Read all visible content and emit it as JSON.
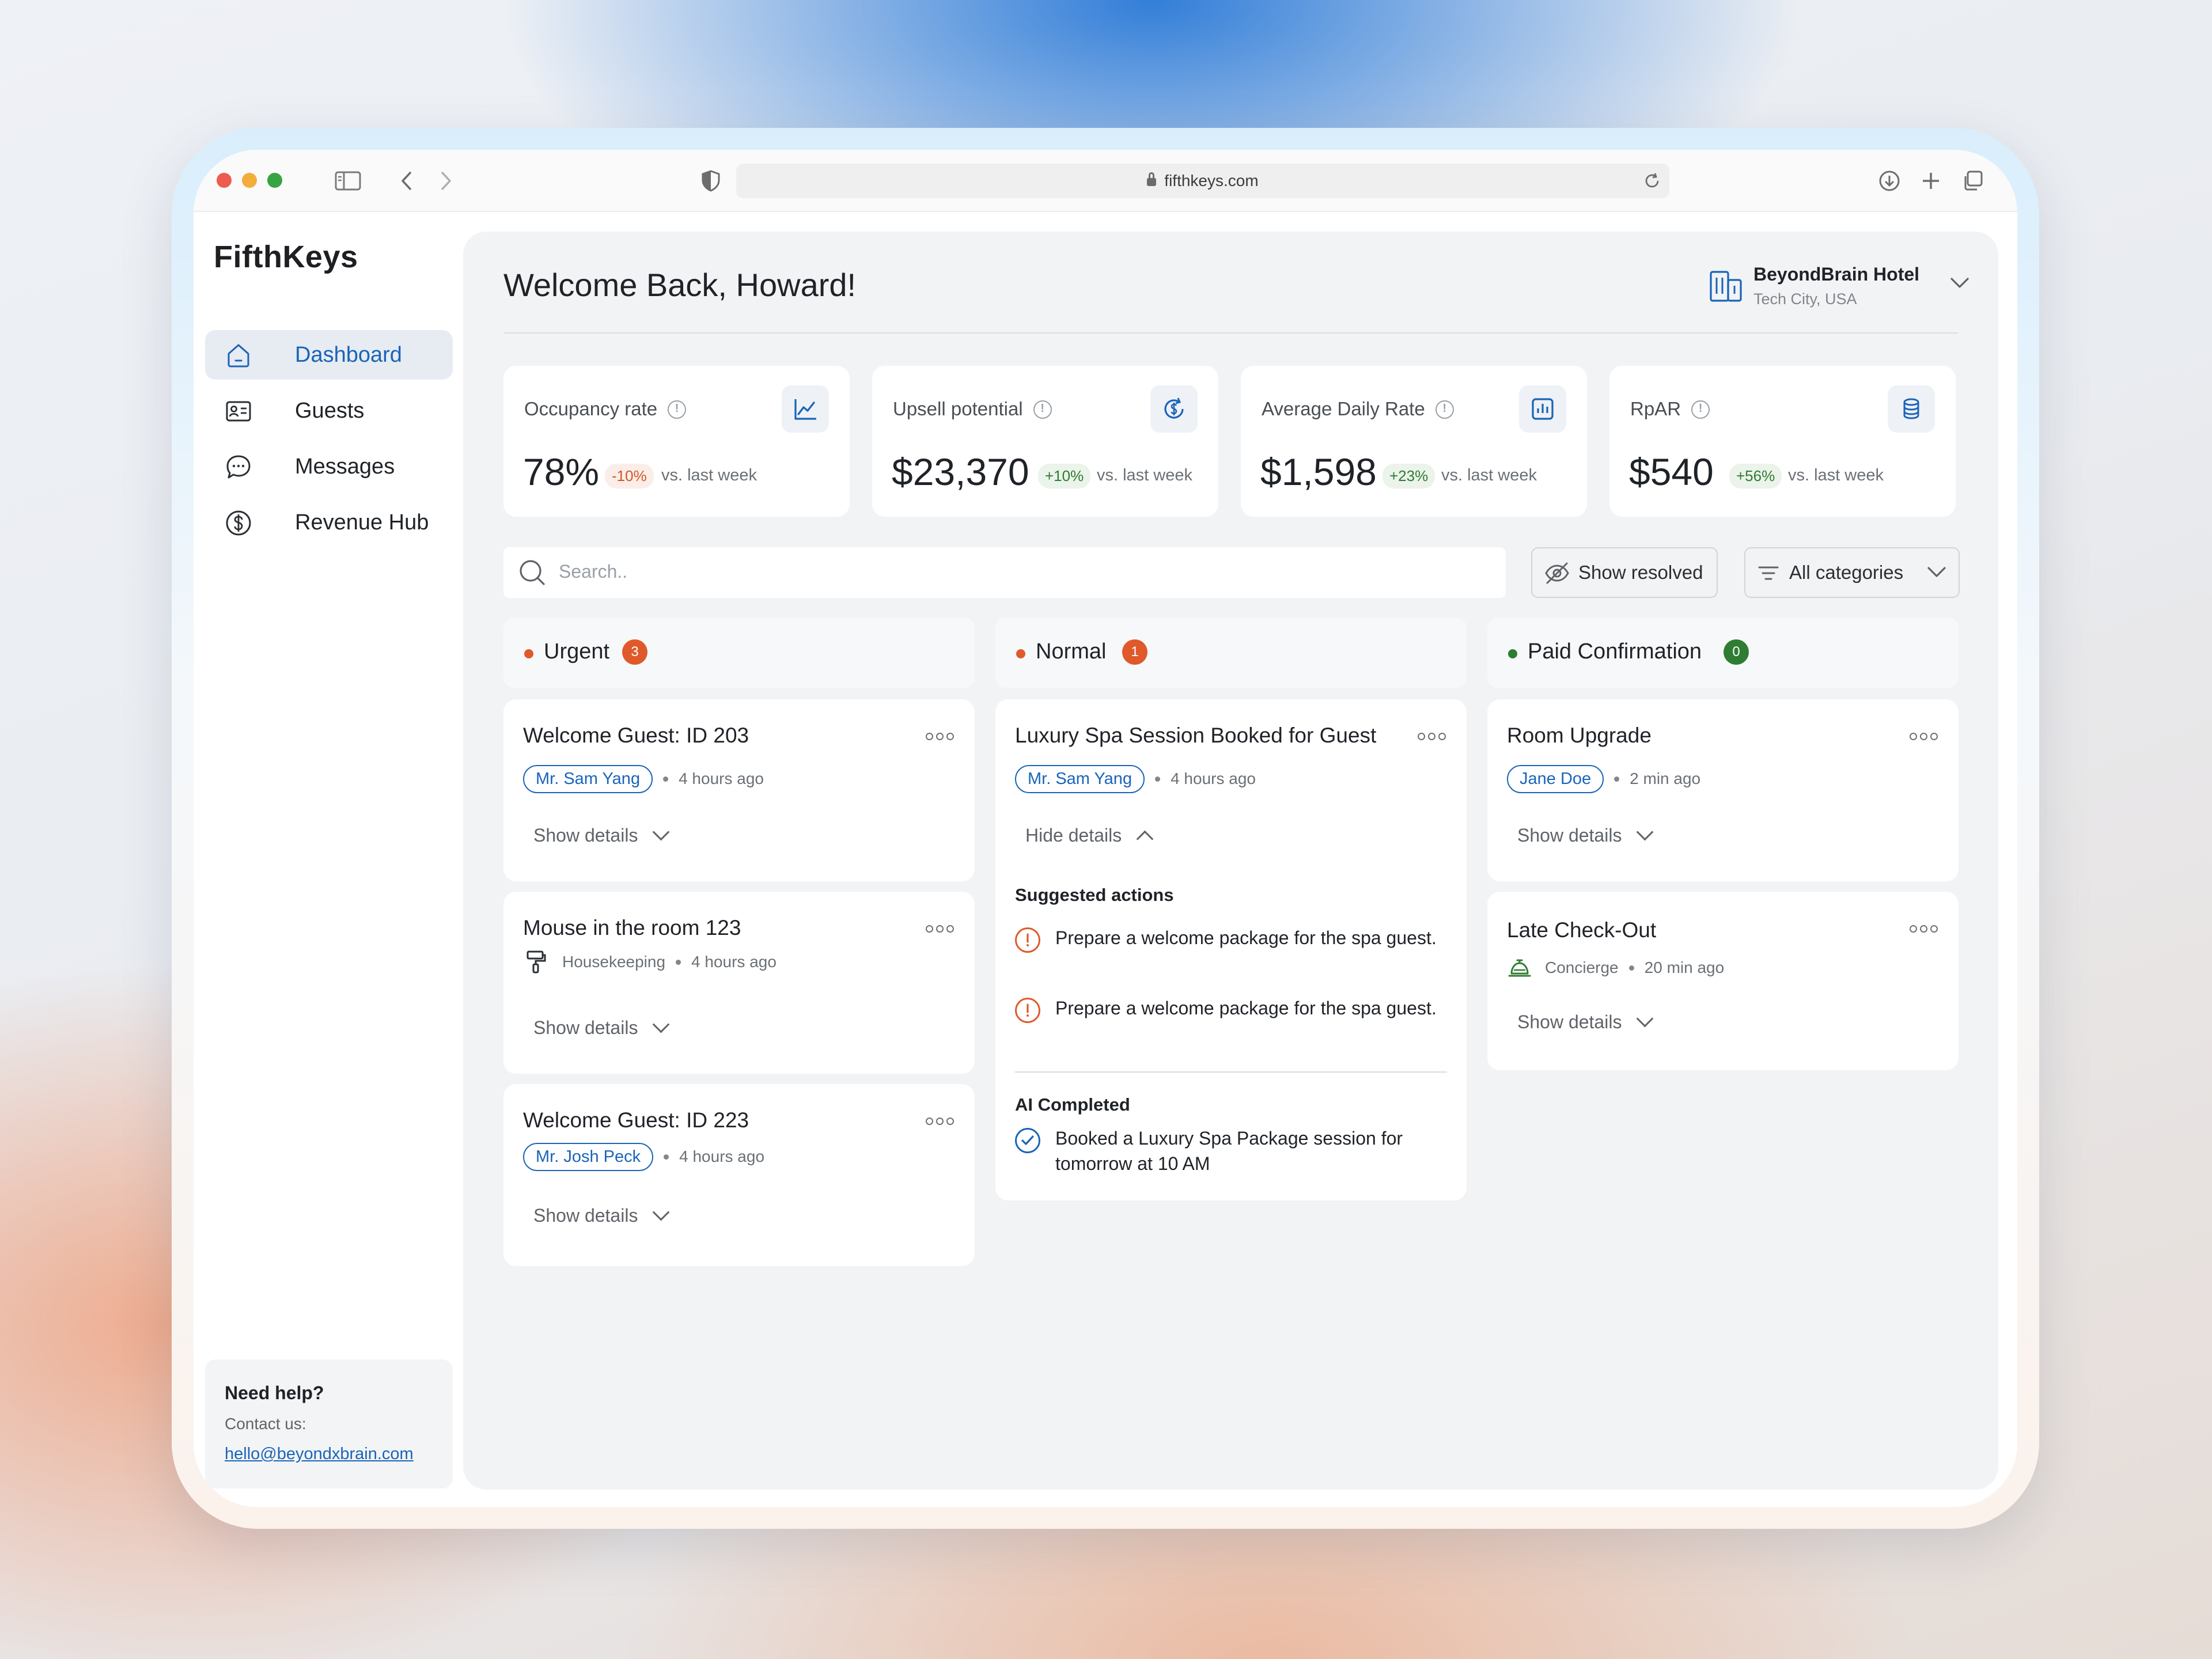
{
  "browser": {
    "url": "fifthkeys.com"
  },
  "sidebar": {
    "brand": "FifthKeys",
    "items": [
      {
        "label": "Dashboard",
        "icon": "home-icon",
        "active": true
      },
      {
        "label": "Guests",
        "icon": "id-card-icon"
      },
      {
        "label": "Messages",
        "icon": "chat-icon"
      },
      {
        "label": "Revenue Hub",
        "icon": "dollar-icon"
      }
    ],
    "help": {
      "title": "Need help?",
      "contact": "Contact us:",
      "email": "hello@beyondxbrain.com"
    }
  },
  "header": {
    "welcome": "Welcome Back, Howard!",
    "hotel": {
      "name": "BeyondBrain Hotel",
      "location": "Tech City, USA"
    }
  },
  "stats": [
    {
      "title": "Occupancy rate",
      "value": "78%",
      "delta": "-10%",
      "trend": "negative",
      "vs": "vs. last week",
      "icon": "line-chart-icon"
    },
    {
      "title": "Upsell potential",
      "value": "$23,370",
      "delta": "+10%",
      "trend": "positive",
      "vs": "vs. last week",
      "icon": "dollar-refresh-icon"
    },
    {
      "title": "Average Daily Rate",
      "value": "$1,598",
      "delta": "+23%",
      "trend": "positive",
      "vs": "vs. last week",
      "icon": "bar-chart-icon"
    },
    {
      "title": "RpAR",
      "value": "$540",
      "delta": "+56%",
      "trend": "positive",
      "vs": "vs. last week",
      "icon": "coins-icon"
    }
  ],
  "toolbar": {
    "search_placeholder": "Search..",
    "show_resolved": "Show resolved",
    "categories": "All categories"
  },
  "columns": [
    {
      "name": "Urgent",
      "count": "3",
      "color": "#e0592a"
    },
    {
      "name": "Normal",
      "count": "1",
      "color": "#e0592a"
    },
    {
      "name": "Paid Confirmation",
      "count": "0",
      "color": "#2e7d32"
    }
  ],
  "cards": {
    "urgent": [
      {
        "title": "Welcome Guest: ID 203",
        "tag": "Mr. Sam Yang",
        "time": "4 hours ago",
        "details": "Show details"
      },
      {
        "title": "Mouse in the room 123",
        "dept": "Housekeeping",
        "time": "4 hours ago",
        "details": "Show details"
      },
      {
        "title": "Welcome Guest: ID 223",
        "tag": "Mr. Josh Peck",
        "time": "4 hours ago",
        "details": "Show details"
      }
    ],
    "normal": [
      {
        "title": "Luxury Spa Session Booked for Guest",
        "tag": "Mr. Sam Yang",
        "time": "4 hours ago",
        "details": "Hide details",
        "suggested_title": "Suggested actions",
        "suggested": [
          "Prepare a welcome package for the spa guest.",
          "Prepare a welcome package for the spa guest."
        ],
        "ai_title": "AI Completed",
        "ai": [
          "Booked a Luxury Spa Package session for tomorrow at 10 AM"
        ]
      }
    ],
    "paid": [
      {
        "title": "Room Upgrade",
        "tag": "Jane Doe",
        "time": "2 min ago",
        "details": "Show details"
      },
      {
        "title": "Late Check-Out",
        "dept": "Concierge",
        "time": "20 min ago",
        "details": "Show details"
      }
    ]
  },
  "colors": {
    "accent": "#1a64b8",
    "urgent": "#e0592a",
    "positive": "#2e7d32"
  }
}
